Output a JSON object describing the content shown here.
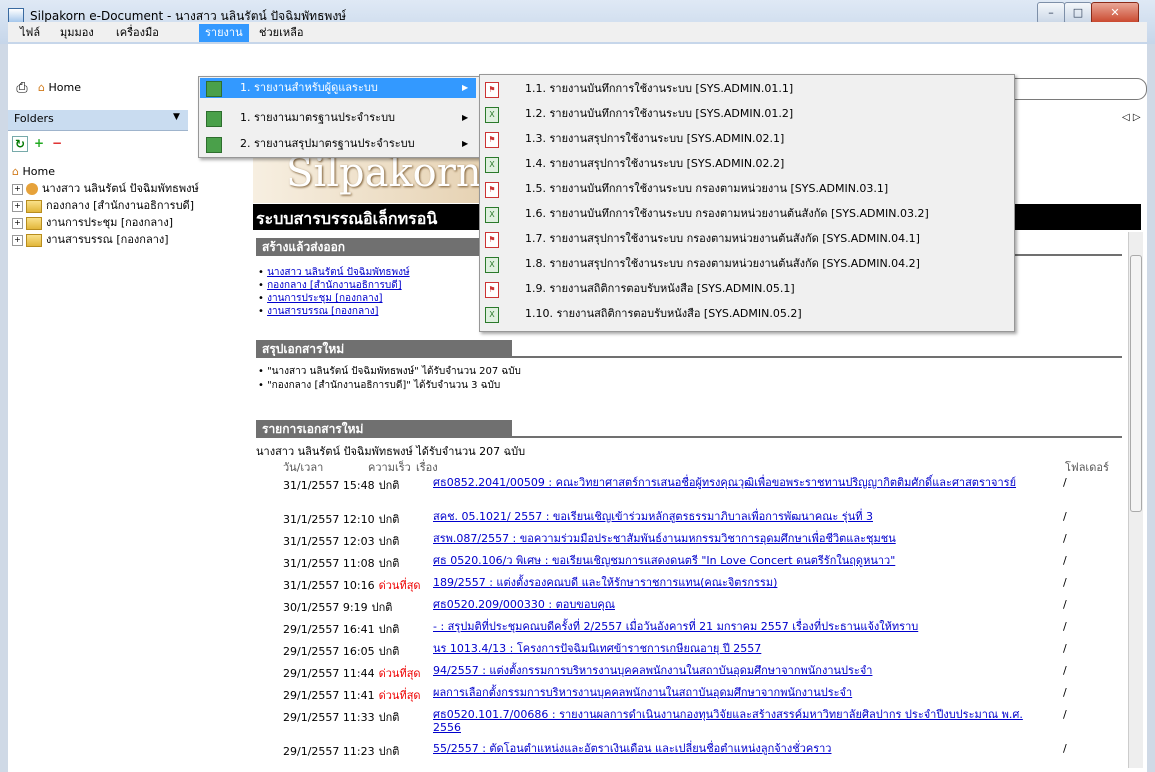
{
  "window": {
    "title": "Silpakorn e-Document - นางสาว นลินรัตน์ ปัจฉิมพัทธพงษ์",
    "min": "–",
    "max": "□",
    "close": "✕"
  },
  "menubar": {
    "items": [
      "ไฟล์",
      "มุมมอง",
      "เครื่องมือ",
      "รายงาน",
      "ช่วยเหลือ"
    ]
  },
  "toolbar": {
    "print_icon": "printer-icon",
    "home_label": "Home"
  },
  "folders": {
    "title": "Folders",
    "home": "Home",
    "items": [
      "นางสาว นลินรัตน์ ปัจฉิมพัทธพงษ์",
      "กองกลาง [สำนักงานอธิการบดี]",
      "งานการประชุม [กองกลาง]",
      "งานสารบรรณ [กองกลาง]"
    ]
  },
  "submenu": [
    "1. รายงานสำหรับผู้ดูแลระบบ",
    "1. รายงานมาตรฐานประจำระบบ",
    "2. รายงานสรุปมาตรฐานประจำระบบ"
  ],
  "report_menu": [
    {
      "label": "1.1. รายงานบันทึกการใช้งานระบบ [SYS.ADMIN.01.1]",
      "type": "pdf"
    },
    {
      "label": "1.2. รายงานบันทึกการใช้งานระบบ [SYS.ADMIN.01.2]",
      "type": "xls"
    },
    {
      "label": "1.3. รายงานสรุปการใช้งานระบบ [SYS.ADMIN.02.1]",
      "type": "pdf"
    },
    {
      "label": "1.4. รายงานสรุปการใช้งานระบบ [SYS.ADMIN.02.2]",
      "type": "xls"
    },
    {
      "label": "1.5. รายงานบันทึกการใช้งานระบบ กรองตามหน่วยงาน [SYS.ADMIN.03.1]",
      "type": "pdf"
    },
    {
      "label": "1.6. รายงานบันทึกการใช้งานระบบ กรองตามหน่วยงานต้นสังกัด [SYS.ADMIN.03.2]",
      "type": "xls"
    },
    {
      "label": "1.7. รายงานสรุปการใช้งานระบบ กรองตามหน่วยงานต้นสังกัด [SYS.ADMIN.04.1]",
      "type": "pdf"
    },
    {
      "label": "1.8. รายงานสรุปการใช้งานระบบ กรองตามหน่วยงานต้นสังกัด [SYS.ADMIN.04.2]",
      "type": "xls"
    },
    {
      "label": "1.9. รายงานสถิติการตอบรับหนังสือ [SYS.ADMIN.05.1]",
      "type": "pdf"
    },
    {
      "label": "1.10. รายงานสถิติการตอบรับหนังสือ [SYS.ADMIN.05.2]",
      "type": "xls"
    }
  ],
  "content": {
    "banner": "Silpakorn",
    "system_title": "ระบบสารบรรณอิเล็กทรอนิ",
    "created_hdr": "สร้างแล้วส่งออก",
    "created_links": [
      "นางสาว นลินรัตน์ ปัจฉิมพัทธพงษ์",
      "กองกลาง [สำนักงานอธิการบดี]",
      "งานการประชุม [กองกลาง]",
      "งานสารบรรณ [กองกลาง]"
    ],
    "summary_hdr": "สรุปเอกสารใหม่",
    "summary": [
      "\"นางสาว นลินรัตน์ ปัจฉิมพัทธพงษ์\" ได้รับจำนวน 207 ฉบับ",
      "\"กองกลาง [สำนักงานอธิการบดี]\" ได้รับจำนวน 3 ฉบับ"
    ],
    "list_hdr": "รายการเอกสารใหม่",
    "recipient": "นางสาว นลินรัตน์ ปัจฉิมพัทธพงษ์ ได้รับจำนวน 207 ฉบับ",
    "col_date": "วัน/เวลา",
    "col_speed": "ความเร็ว",
    "col_subject": "เรื่อง",
    "col_folder": "โฟลเดอร์"
  },
  "documents": [
    {
      "date": "31/1/2557 15:48",
      "speed": "ปกติ",
      "subject": "ศธ0852.2041/00509 : คณะวิทยาศาสตร์การเสนอชื่อผู้ทรงคุณวุฒิเพื่อขอพระราชทานปริญญากิตติมศักดิ์และศาสตราจารย์",
      "folder": "/"
    },
    {
      "date": "31/1/2557 12:10",
      "speed": "ปกติ",
      "subject": "สคช. 05.1021/ 2557 : ขอเรียนเชิญเข้าร่วมหลักสูตรธรรมาภิบาลเพื่อการพัฒนาคณะ รุ่นที่ 3",
      "folder": "/"
    },
    {
      "date": "31/1/2557 12:03",
      "speed": "ปกติ",
      "subject": "สรพ.087/2557 : ขอความร่วมมือประชาสัมพันธ์งานมหกรรมวิชาการอุดมศึกษาเพื่อชีวิตและชุมชน",
      "folder": "/"
    },
    {
      "date": "31/1/2557 11:08",
      "speed": "ปกติ",
      "subject": "ศธ 0520.106/ว พิเศษ : ขอเรียนเชิญชมการแสดงดนตรี \"In Love Concert ดนตรีรักในฤดูหนาว\"",
      "folder": "/"
    },
    {
      "date": "31/1/2557 10:16",
      "speed": "ด่วนที่สุด",
      "subject": "189/2557 : แต่งตั้งรองคณบดี และให้รักษาราชการแทน(คณะจิตรกรรม)",
      "folder": "/"
    },
    {
      "date": "30/1/2557 9:19",
      "speed": "ปกติ",
      "subject": "ศธ0520.209/000330 : ตอบขอบคุณ",
      "folder": "/"
    },
    {
      "date": "29/1/2557 16:41",
      "speed": "ปกติ",
      "subject": "- : สรุปมติที่ประชุมคณบดีครั้งที่ 2/2557 เมื่อวันอังคารที่ 21 มกราคม 2557 เรื่องที่ประธานแจ้งให้ทราบ",
      "folder": "/"
    },
    {
      "date": "29/1/2557 16:05",
      "speed": "ปกติ",
      "subject": "นร 1013.4/13 : โครงการปัจฉิมนิเทศข้าราชการเกษียณอายุ ปี 2557",
      "folder": "/"
    },
    {
      "date": "29/1/2557 11:44",
      "speed": "ด่วนที่สุด",
      "subject": "94/2557 : แต่งตั้งกรรมการบริหารงานบุคคลพนักงานในสถาบันอุดมศึกษาจากพนักงานประจำ",
      "folder": "/"
    },
    {
      "date": "29/1/2557 11:41",
      "speed": "ด่วนที่สุด",
      "subject": "ผลการเลือกตั้งกรรมการบริหารงานบุคคลพนักงานในสถาบันอุดมศึกษาจากพนักงานประจำ",
      "folder": "/"
    },
    {
      "date": "29/1/2557 11:33",
      "speed": "ปกติ",
      "subject": "ศธ0520.101.7/00686 : รายงานผลการดำเนินงานกองทุนวิจัยและสร้างสรรค์มหาวิทยาลัยศิลปากร ประจำปีงบประมาณ พ.ศ. 2556",
      "folder": "/"
    },
    {
      "date": "29/1/2557 11:23",
      "speed": "ปกติ",
      "subject": "55/2557 : ตัดโอนตำแหน่งและอัตราเงินเดือน และเปลี่ยนชื่อตำแหน่งลูกจ้างชั่วคราว",
      "folder": "/"
    }
  ]
}
